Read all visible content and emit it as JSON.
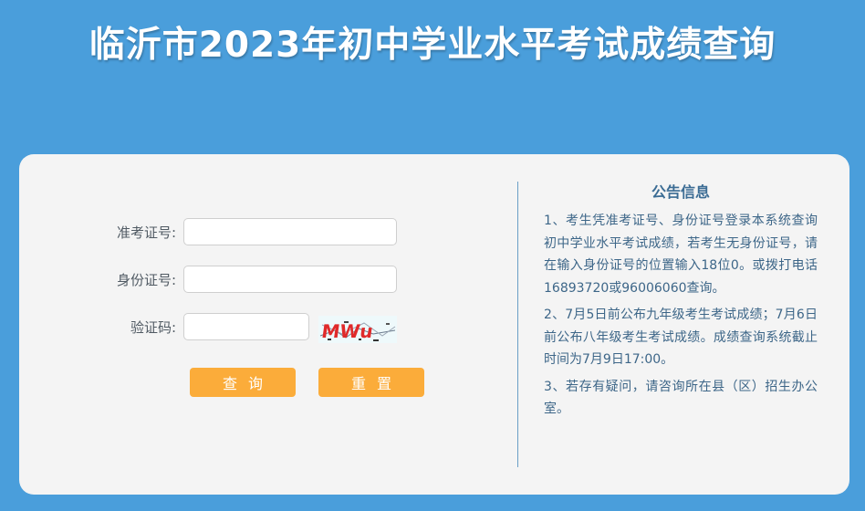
{
  "page": {
    "title": "临沂市2023年初中学业水平考试成绩查询"
  },
  "form": {
    "exam_number_label": "准考证号:",
    "exam_number_value": "",
    "id_number_label": "身份证号:",
    "id_number_value": "",
    "captcha_label": "验证码:",
    "captcha_value": "",
    "captcha_text": "MWu",
    "search_button": "查询",
    "reset_button": "重置"
  },
  "notice": {
    "title": "公告信息",
    "items": [
      "1、考生凭准考证号、身份证号登录本系统查询初中学业水平考试成绩，若考生无身份证号，请在输入身份证号的位置输入18位0。或拨打电话16893720或96006060查询。",
      "2、7月5日前公布九年级考生考试成绩；7月6日前公布八年级考生考试成绩。成绩查询系统截止时间为7月9日17:00。",
      "3、若存有疑问，请咨询所在县（区）招生办公室。"
    ]
  },
  "colors": {
    "background": "#4a9edb",
    "panel": "#f4f4f4",
    "button": "#fbac3a",
    "notice_text": "#3d6688"
  }
}
